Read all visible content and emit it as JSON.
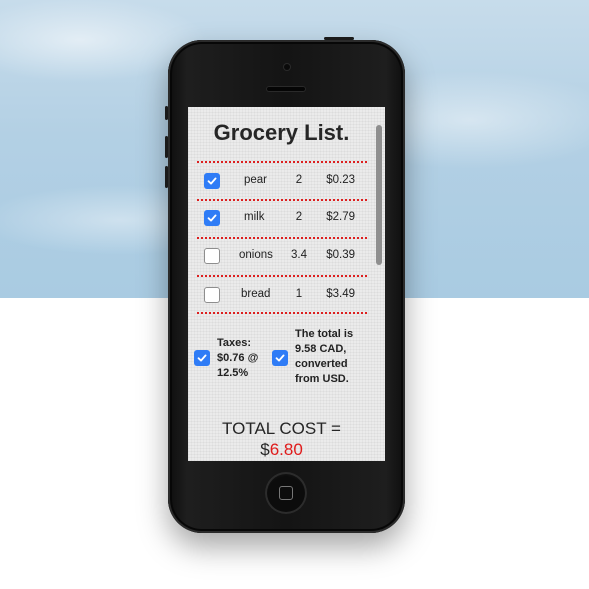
{
  "title": "Grocery List.",
  "items": [
    {
      "name": "pear",
      "qty": "2",
      "price": "$0.23",
      "checked": true
    },
    {
      "name": "milk",
      "qty": "2",
      "price": "$2.79",
      "checked": true
    },
    {
      "name": "onions",
      "qty": "3.4",
      "price": "$0.39",
      "checked": false
    },
    {
      "name": "bread",
      "qty": "1",
      "price": "$3.49",
      "checked": false
    }
  ],
  "taxes": {
    "line1": "Taxes:",
    "line2": "$0.76 @",
    "line3": "12.5%",
    "checked": true
  },
  "conversion": {
    "line1": "The total is",
    "line2": "9.58 CAD,",
    "line3": "converted",
    "line4": "from USD.",
    "checked": true
  },
  "total": {
    "label": "TOTAL COST =",
    "currency": "$",
    "amount": "6.80"
  },
  "colors": {
    "accent": "#2f7cf6",
    "divider": "#dd1f1f",
    "total_amount": "#e01b1b"
  }
}
